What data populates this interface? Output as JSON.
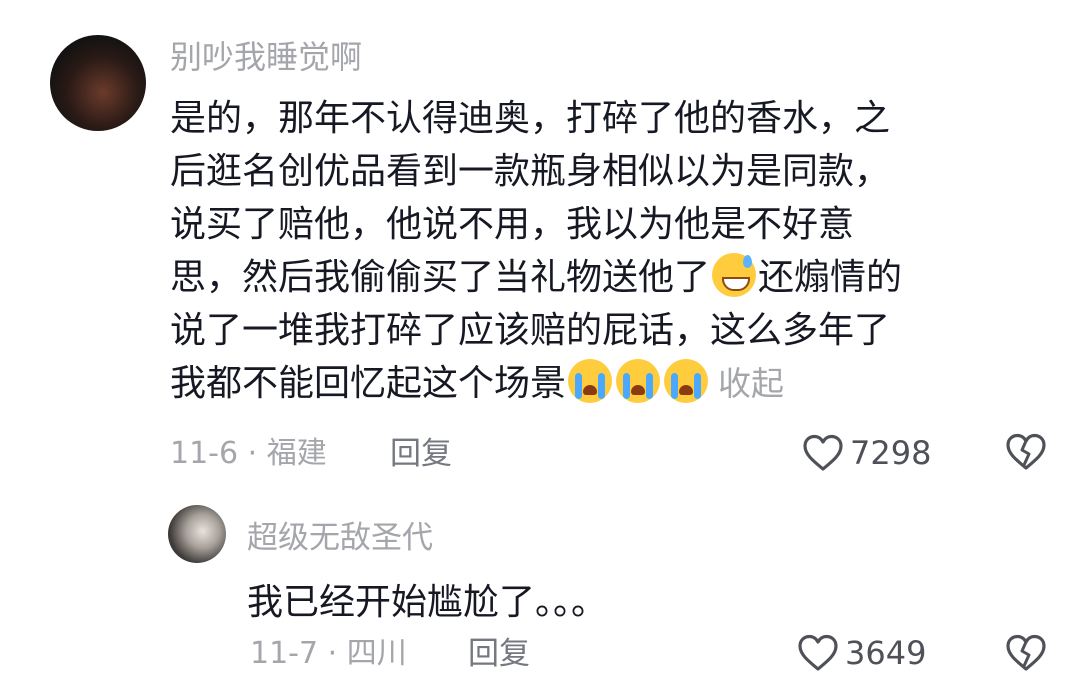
{
  "comments": [
    {
      "username": "别吵我睡觉啊",
      "lines": [
        "是的，那年不认得迪奥，打碎了他的香水，之",
        "后逛名创优品看到一款瓶身相似以为是同款，",
        "说买了赔他，他说不用，我以为他是不好意",
        "思，然后我偷偷买了当礼物送他了",
        "还煽情的",
        "说了一堆我打碎了应该赔的屁话，这么多年了",
        "我都不能回忆起这个场景"
      ],
      "collapse_label": "收起",
      "date_location": "11-6 · 福建",
      "reply_label": "回复",
      "likes": "7298"
    },
    {
      "username": "超级无敌圣代",
      "text": "我已经开始尴尬了。。。",
      "date_location": "11-7 · 四川",
      "reply_label": "回复",
      "likes": "3649"
    }
  ],
  "icons": {
    "emoji_sweat": "grinning-sweat-emoji",
    "emoji_cry": "loudly-crying-emoji",
    "like": "heart-outline-icon",
    "dislike": "broken-heart-icon"
  },
  "colors": {
    "text": "#161823",
    "secondary": "#a4a6ab",
    "reply": "#757880"
  }
}
